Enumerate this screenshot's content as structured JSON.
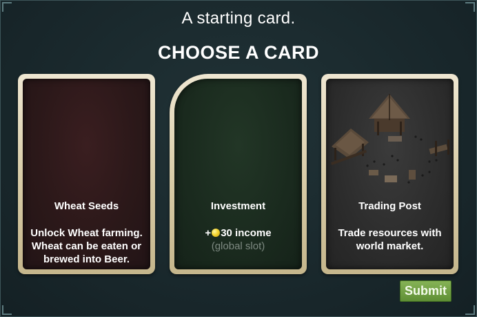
{
  "header": {
    "subtitle": "A starting card.",
    "title": "CHOOSE A CARD"
  },
  "cards": [
    {
      "name": "Wheat Seeds",
      "description": "Unlock Wheat farming. Wheat can be eaten or brewed into Beer.",
      "theme_color": "#2b1819"
    },
    {
      "name": "Investment",
      "income_prefix": "+",
      "income_text": "30 income",
      "slot_note": "(global slot)",
      "icon": "gold-coin-icon",
      "theme_color": "#1a2a1e"
    },
    {
      "name": "Trading Post",
      "description": "Trade resources with world market.",
      "art": "trading-post-buildings-illustration",
      "theme_color": "#2c2c2c"
    }
  ],
  "actions": {
    "submit_label": "Submit",
    "submit_color": "#6f9d43"
  }
}
